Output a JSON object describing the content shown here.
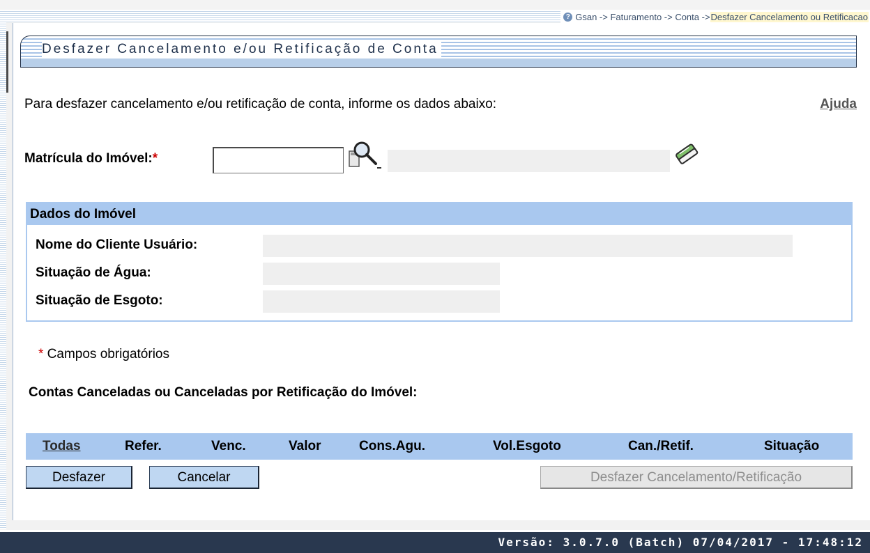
{
  "breadcrumb": {
    "path": "Gsan -> Faturamento -> Conta -> ",
    "current": "Desfazer Cancelamento ou Retificacao"
  },
  "page": {
    "title": "Desfazer Cancelamento e/ou Retificação de Conta",
    "intro": "Para desfazer cancelamento e/ou retificação de conta, informe os dados abaixo:",
    "help_link": "Ajuda"
  },
  "form": {
    "matricula_label": "Matrícula do Imóvel:",
    "required_mark": "*",
    "matricula_value": "",
    "imovel_description": ""
  },
  "dados_imovel": {
    "title": "Dados do Imóvel",
    "fields": [
      {
        "label": "Nome do Cliente Usuário:",
        "value": ""
      },
      {
        "label": "Situação de Água:",
        "value": ""
      },
      {
        "label": "Situação de Esgoto:",
        "value": ""
      }
    ]
  },
  "required_note": {
    "mark": "*",
    "text": " Campos obrigatórios"
  },
  "contas": {
    "title": "Contas Canceladas ou Canceladas por Retificação do Imóvel:",
    "columns": [
      "Todas",
      "Refer.",
      "Venc.",
      "Valor",
      "Cons.Agu.",
      "Vol.Esgoto",
      "Can./Retif.",
      "Situação"
    ]
  },
  "buttons": {
    "desfazer": "Desfazer",
    "cancelar": "Cancelar",
    "desfazer_cancelamento": "Desfazer Cancelamento/Retificação"
  },
  "footer": {
    "version": "Versão: 3.0.7.0 (Batch) 07/04/2017 - 17:48:12"
  },
  "colors": {
    "section_header": "#a9c8ef",
    "footer_bg": "#29384f",
    "required": "#cc0000"
  }
}
